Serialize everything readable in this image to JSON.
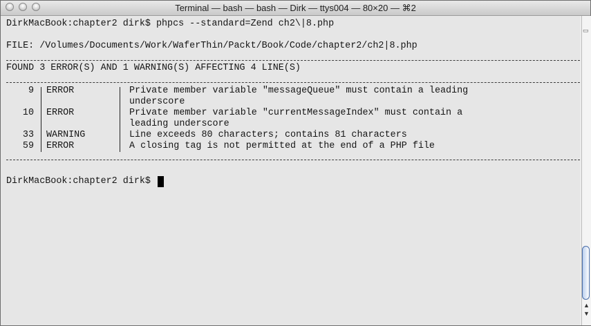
{
  "window": {
    "title": "Terminal — bash — bash — Dirk — ttys004 — 80×20 — ⌘2",
    "traffic_lights": [
      "close",
      "minimize",
      "zoom"
    ]
  },
  "terminal": {
    "command_line": "DirkMacBook:chapter2 dirk$ phpcs --standard=Zend ch2\\|8.php",
    "file_line": "FILE: /Volumes/Documents/Work/WaferThin/Packt/Book/Code/chapter2/ch2|8.php",
    "found_line": "FOUND 3 ERROR(S) AND 1 WARNING(S) AFFECTING 4 LINE(S)",
    "rows": [
      {
        "line": "9",
        "type": "ERROR",
        "message": "Private member variable \"messageQueue\" must contain a leading",
        "continuation": "underscore"
      },
      {
        "line": "10",
        "type": "ERROR",
        "message": "Private member variable \"currentMessageIndex\" must contain a",
        "continuation": "leading underscore"
      },
      {
        "line": "33",
        "type": "WARNING",
        "message": "Line exceeds 80 characters; contains 81 characters",
        "continuation": ""
      },
      {
        "line": "59",
        "type": "ERROR",
        "message": "A closing tag is not permitted at the end of a PHP file",
        "continuation": ""
      }
    ],
    "prompt": "DirkMacBook:chapter2 dirk$ "
  }
}
